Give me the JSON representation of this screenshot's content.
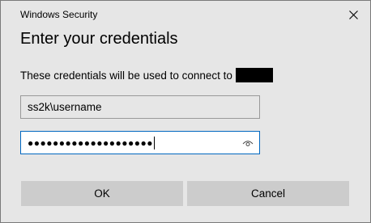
{
  "window": {
    "title": "Windows Security",
    "close_icon": "close-icon"
  },
  "dialog": {
    "heading": "Enter your credentials",
    "message": "These credentials will be used to connect to"
  },
  "fields": {
    "username_value": "ss2k\\username",
    "password_value": "●●●●●●●●●●●●●●●●●●●●",
    "reveal_icon": "eye-icon"
  },
  "buttons": {
    "ok_label": "OK",
    "cancel_label": "Cancel"
  },
  "colors": {
    "background": "#e6e6e6",
    "focus_border": "#0067c0",
    "button_bg": "#cccccc"
  }
}
